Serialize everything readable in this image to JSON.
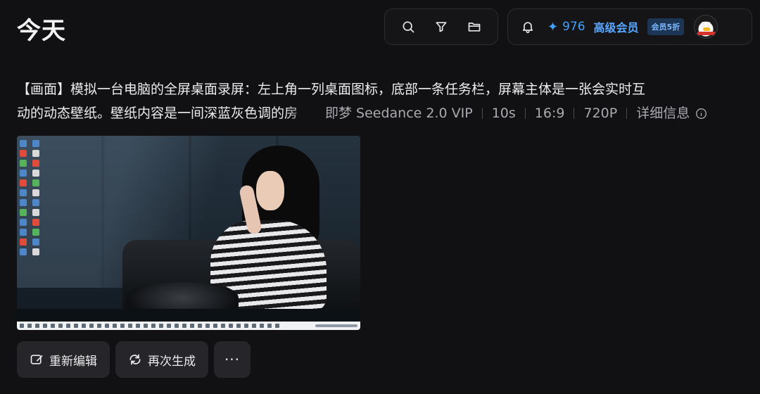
{
  "page": {
    "title": "今天"
  },
  "toolbar": {
    "icons": [
      "search-icon",
      "filter-icon",
      "folder-icon"
    ]
  },
  "account": {
    "bell_icon": "bell-icon",
    "credits_icon": "sparkle-icon",
    "credits": "976",
    "membership": "高级会员",
    "badge": "会员5折",
    "avatar": "penguin-avatar"
  },
  "prompt": {
    "line1": "【画面】模拟一台电脑的全屏桌面录屏：左上角一列桌面图标，底部一条任务栏，屏幕主体是一张会实时互",
    "line2": "动的动态壁纸。壁纸内容是一间深蓝灰色调的房"
  },
  "meta": {
    "model": "即梦 Seedance 2.0 VIP",
    "duration": "10s",
    "ratio": "16:9",
    "resolution": "720P",
    "details": "详细信息"
  },
  "actions": {
    "reedit": "重新编辑",
    "regenerate": "再次生成",
    "more": "···"
  },
  "colors": {
    "background": "#111113",
    "accent": "#3fa0ff",
    "button": "#26262a"
  }
}
